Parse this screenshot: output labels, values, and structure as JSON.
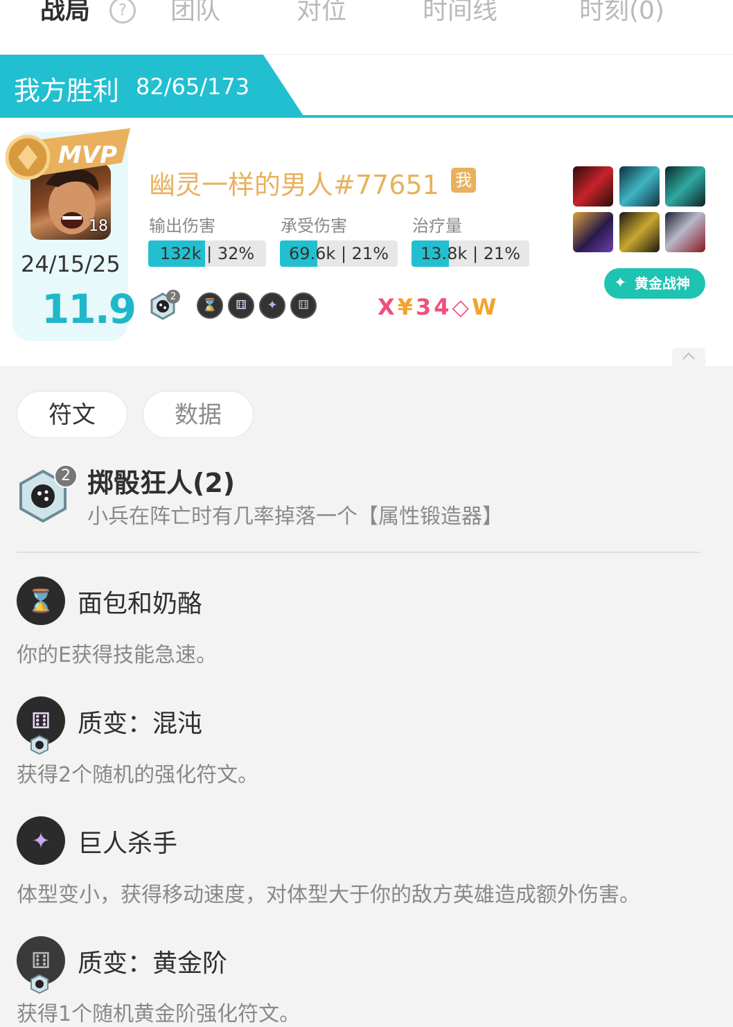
{
  "tabs": [
    {
      "label": "战局"
    },
    {
      "label": "团队"
    },
    {
      "label": "对位"
    },
    {
      "label": "时间线"
    },
    {
      "label": "时刻(0)"
    }
  ],
  "banner": {
    "title": "我方胜利",
    "score": "82/65/173"
  },
  "player": {
    "mvp_label": "MVP",
    "level": "18",
    "kda": "24/15/25",
    "score": "11.9",
    "name": "幽灵一样的男人#77651",
    "me_badge": "我",
    "stats": [
      {
        "label": "输出伤害",
        "value": "132k | 32%",
        "fraction": 0.32
      },
      {
        "label": "承受伤害",
        "value": "69.6k | 21%",
        "fraction": 0.21
      },
      {
        "label": "治疗量",
        "value": "13.8k | 21%",
        "fraction": 0.21
      }
    ],
    "title_badge": "黄金战神",
    "trait_count": "2",
    "stat_letters": [
      "X",
      "¥",
      "3",
      "4",
      "◇",
      "W"
    ]
  },
  "filters": {
    "runes": "符文",
    "data": "数据"
  },
  "trait": {
    "name": "掷骰狂人(2)",
    "count": "2",
    "desc": "小兵在阵亡时有几率掉落一个【属性锻造器】"
  },
  "augments": [
    {
      "name": "面包和奶酪",
      "desc": "你的E获得技能急速。",
      "icon": "hourglass-icon"
    },
    {
      "name": "质变：混沌",
      "desc": "获得2个随机的强化符文。",
      "icon": "dice-icon"
    },
    {
      "name": "巨人杀手",
      "desc": "体型变小，获得移动速度，对体型大于你的敌方英雄造成额外伤害。",
      "icon": "boot-icon"
    },
    {
      "name": "质变：黄金阶",
      "desc": "获得1个随机黄金阶强化符文。",
      "icon": "dice-icon"
    }
  ],
  "colors": {
    "accent": "#22bfd0",
    "gold": "#e9b15d",
    "badge_green": "#1ec3b1"
  }
}
